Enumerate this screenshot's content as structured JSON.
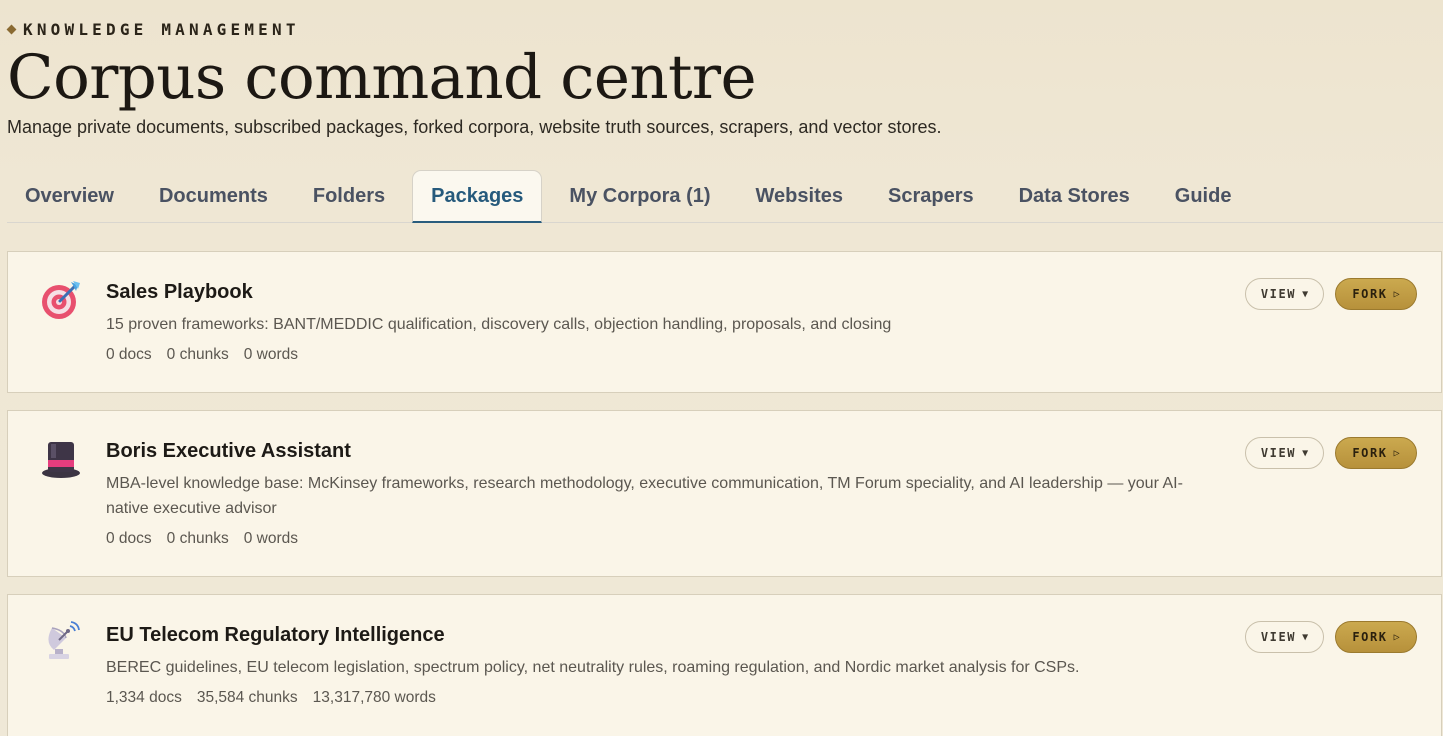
{
  "header": {
    "eyebrow": "KNOWLEDGE MANAGEMENT",
    "title": "Corpus command centre",
    "subtitle": "Manage private documents, subscribed packages, forked corpora, website truth sources, scrapers, and vector stores."
  },
  "tabs": [
    {
      "label": "Overview",
      "active": false
    },
    {
      "label": "Documents",
      "active": false
    },
    {
      "label": "Folders",
      "active": false
    },
    {
      "label": "Packages",
      "active": true
    },
    {
      "label": "My Corpora (1)",
      "active": false
    },
    {
      "label": "Websites",
      "active": false
    },
    {
      "label": "Scrapers",
      "active": false
    },
    {
      "label": "Data Stores",
      "active": false
    },
    {
      "label": "Guide",
      "active": false
    }
  ],
  "packages": [
    {
      "icon": "target-dart-icon",
      "title": "Sales Playbook",
      "description": "15 proven frameworks: BANT/MEDDIC qualification, discovery calls, objection handling, proposals, and closing",
      "docs": "0 docs",
      "chunks": "0 chunks",
      "words": "0 words",
      "view_label": "VIEW",
      "view_glyph": "▼",
      "fork_label": "FORK",
      "fork_glyph": "▷"
    },
    {
      "icon": "top-hat-icon",
      "title": "Boris Executive Assistant",
      "description": "MBA-level knowledge base: McKinsey frameworks, research methodology, executive communication, TM Forum speciality, and AI leadership — your AI-native executive advisor",
      "docs": "0 docs",
      "chunks": "0 chunks",
      "words": "0 words",
      "view_label": "VIEW",
      "view_glyph": "▼",
      "fork_label": "FORK",
      "fork_glyph": "▷"
    },
    {
      "icon": "satellite-antenna-icon",
      "title": "EU Telecom Regulatory Intelligence",
      "description": "BEREC guidelines, EU telecom legislation, spectrum policy, net neutrality rules, roaming regulation, and Nordic market analysis for CSPs.",
      "docs": "1,334 docs",
      "chunks": "35,584 chunks",
      "words": "13,317,780 words",
      "view_label": "VIEW",
      "view_glyph": "▼",
      "fork_label": "FORK",
      "fork_glyph": "▷"
    }
  ],
  "colors": {
    "accent": "#265a7c",
    "fork_gold": "#c4a048",
    "background": "#efe8d7",
    "card": "#faf5e8"
  }
}
